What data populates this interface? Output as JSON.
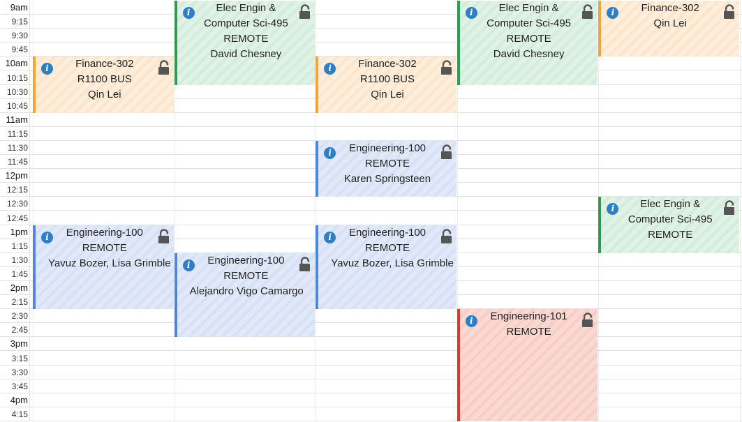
{
  "time_slots": [
    "9am",
    "9:15",
    "9:30",
    "9:45",
    "10am",
    "10:15",
    "10:30",
    "10:45",
    "11am",
    "11:15",
    "11:30",
    "11:45",
    "12pm",
    "12:15",
    "12:30",
    "12:45",
    "1pm",
    "1:15",
    "1:30",
    "1:45",
    "2pm",
    "2:15",
    "2:30",
    "2:45",
    "3pm",
    "3:15",
    "3:30",
    "3:45",
    "4pm",
    "4:15"
  ],
  "events": [
    {
      "id": "ev1",
      "day": 0,
      "start": "10:00",
      "end": "11:00",
      "color": "orange",
      "lines": [
        "Finance-302",
        "R1100 BUS",
        "Qin Lei"
      ]
    },
    {
      "id": "ev2",
      "day": 0,
      "start": "13:00",
      "end": "14:30",
      "color": "blue",
      "lines": [
        "Engineering-100",
        "REMOTE",
        "Yavuz Bozer, Lisa Grimble"
      ]
    },
    {
      "id": "ev3",
      "day": 1,
      "start": "9:00",
      "end": "10:30",
      "color": "green",
      "lines": [
        "Elec Engin &",
        "Computer Sci-495",
        "REMOTE",
        "David Chesney"
      ]
    },
    {
      "id": "ev4",
      "day": 1,
      "start": "13:30",
      "end": "15:00",
      "color": "blue",
      "lines": [
        "Engineering-100",
        "REMOTE",
        "Alejandro Vigo Camargo"
      ]
    },
    {
      "id": "ev5",
      "day": 2,
      "start": "10:00",
      "end": "11:00",
      "color": "orange",
      "lines": [
        "Finance-302",
        "R1100 BUS",
        "Qin Lei"
      ]
    },
    {
      "id": "ev6",
      "day": 2,
      "start": "11:30",
      "end": "12:30",
      "color": "blue",
      "lines": [
        "Engineering-100",
        "REMOTE",
        "Karen Springsteen"
      ]
    },
    {
      "id": "ev7",
      "day": 2,
      "start": "13:00",
      "end": "14:30",
      "color": "blue",
      "lines": [
        "Engineering-100",
        "REMOTE",
        "Yavuz Bozer, Lisa Grimble"
      ]
    },
    {
      "id": "ev8",
      "day": 3,
      "start": "9:00",
      "end": "10:30",
      "color": "green",
      "lines": [
        "Elec Engin &",
        "Computer Sci-495",
        "REMOTE",
        "David Chesney"
      ]
    },
    {
      "id": "ev9",
      "day": 3,
      "start": "14:30",
      "end": "16:30",
      "color": "red",
      "lines": [
        "Engineering-101",
        "REMOTE"
      ]
    },
    {
      "id": "ev10",
      "day": 4,
      "start": "9:00",
      "end": "10:00",
      "color": "orange",
      "lines": [
        "Finance-302",
        "Qin Lei"
      ]
    },
    {
      "id": "ev11",
      "day": 4,
      "start": "12:30",
      "end": "13:30",
      "color": "green",
      "lines": [
        "Elec Engin &",
        "Computer Sci-495",
        "REMOTE"
      ]
    }
  ],
  "icons": {
    "info": "info-icon",
    "lock": "unlocked-lock-icon"
  }
}
